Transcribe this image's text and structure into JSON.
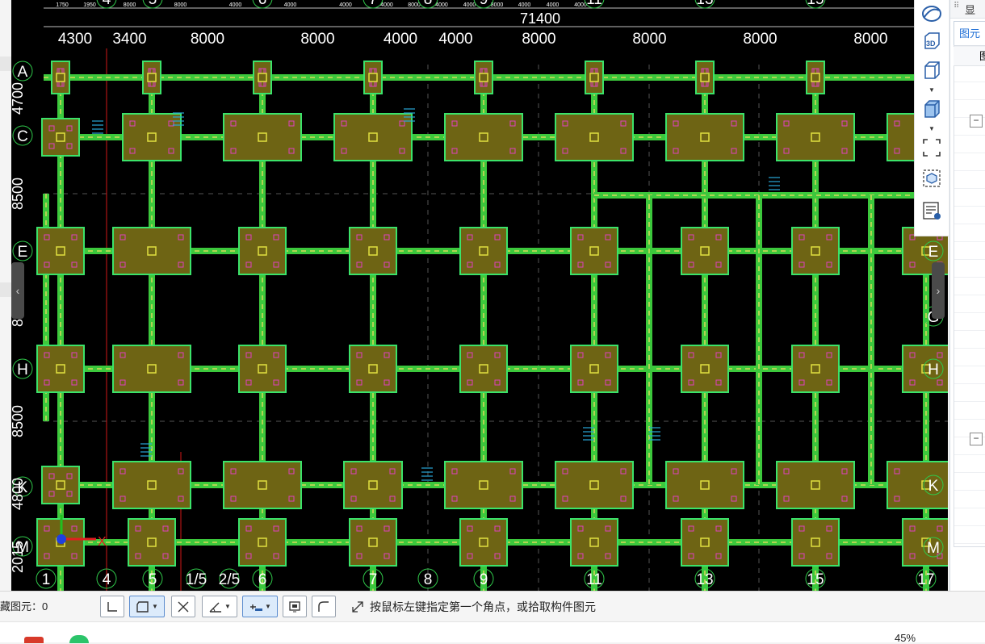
{
  "canvas": {
    "background": "#000000",
    "colors": {
      "beam": "#3cc83c",
      "beam_dash": "#d8d85a",
      "footing_fill": "#6e6414",
      "footing_border": "#3be36a",
      "column": "#e0e040",
      "pile": "#e040c0",
      "axis_text": "#ffffff",
      "dim_text": "#ffffff",
      "annotation": "#28a8d8",
      "red_line": "#d01818"
    },
    "total_dimension": "71400",
    "top_axis_dims": [
      "1750",
      "1950",
      "8000",
      "8000",
      "4000",
      "4000",
      "4000",
      "4000",
      "8000",
      "4000",
      "4000",
      "8000",
      "4000",
      "4000",
      "4000"
    ],
    "bay_dims": [
      "4300",
      "3400",
      "8000",
      "8000",
      "4000",
      "4000",
      "8000",
      "8000",
      "8000",
      "8000"
    ],
    "top_axis_labels": [
      "4",
      "5",
      "6",
      "7",
      "8",
      "9",
      "11",
      "13",
      "15"
    ],
    "bottom_axis_labels": [
      "1",
      "4",
      "5",
      "1/5",
      "2/5",
      "6",
      "7",
      "8",
      "9",
      "11",
      "13",
      "15",
      "17"
    ],
    "row_labels_left": [
      "A",
      "C",
      "E",
      "H",
      "K",
      "M"
    ],
    "row_labels_right": [
      "E",
      "G",
      "H",
      "K",
      "M"
    ],
    "left_dims": [
      "4700",
      "8500",
      "8",
      "8500",
      "4800",
      "2015"
    ],
    "ucs_x_label": "X"
  },
  "view_toolbar": {
    "icons": [
      "orbit-icon",
      "3d-view-icon",
      "cube-view-icon",
      "cube-shaded-icon",
      "window-select-icon",
      "component-view-icon",
      "properties-list-icon"
    ]
  },
  "right_panel": {
    "top_tab_label": "显",
    "tab_label": "图元",
    "header_label": "图",
    "toggles": [
      "−",
      "−"
    ]
  },
  "status_bar": {
    "hidden_count_label": "藏图元：0",
    "buttons": [
      "orthogonal-icon",
      "rectangle-select-icon",
      "cross-select-icon",
      "angle-icon",
      "snap-icon",
      "display-icon",
      "polyline-icon"
    ],
    "prompt_icon": "diagonal-arrow-icon",
    "prompt": "按鼠标左键指定第一个角点，或拾取构件图元"
  },
  "taskbar": {
    "zoom": "45%"
  }
}
